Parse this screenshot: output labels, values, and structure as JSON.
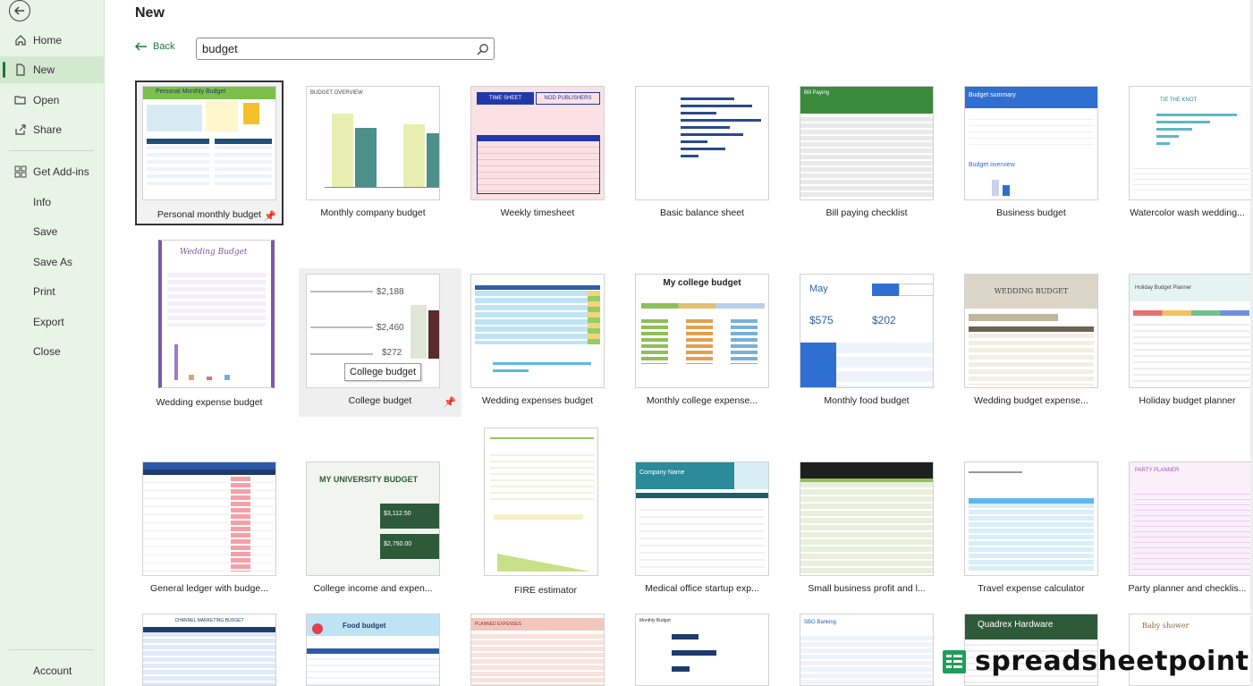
{
  "sidebar": {
    "items": [
      {
        "label": "Home",
        "icon": "home-icon"
      },
      {
        "label": "New",
        "icon": "new-file-icon"
      },
      {
        "label": "Open",
        "icon": "open-folder-icon"
      },
      {
        "label": "Share",
        "icon": "share-icon"
      },
      {
        "label": "Get Add-ins",
        "icon": "add-ins-icon"
      },
      {
        "label": "Info"
      },
      {
        "label": "Save"
      },
      {
        "label": "Save As"
      },
      {
        "label": "Print"
      },
      {
        "label": "Export"
      },
      {
        "label": "Close"
      },
      {
        "label": "Account"
      }
    ]
  },
  "header": {
    "title": "New",
    "back_label": "Back"
  },
  "search": {
    "value": "budget",
    "placeholder": ""
  },
  "tooltip": "College budget",
  "templates": [
    {
      "label": "Personal monthly budget",
      "thumb_title": "Personal Monthly Budget"
    },
    {
      "label": "Monthly company budget",
      "thumb_title": "BUDGET OVERVIEW"
    },
    {
      "label": "Weekly timesheet",
      "thumb_title": "TIME SHEET",
      "thumb_title2": "NOD PUBLISHERS"
    },
    {
      "label": "Basic balance sheet"
    },
    {
      "label": "Bill paying checklist",
      "thumb_title": "Bill Paying"
    },
    {
      "label": "Business budget",
      "thumb_title": "Budget summary",
      "thumb_title2": "Budget overview"
    },
    {
      "label": "Watercolor wash wedding...",
      "thumb_title": "TIE THE KNOT"
    },
    {
      "label": "Wedding expense budget",
      "thumb_title": "Wedding Budget"
    },
    {
      "label": "College budget",
      "values": [
        "$2,188",
        "$2,460",
        "$272"
      ]
    },
    {
      "label": "Wedding expenses budget"
    },
    {
      "label": "Monthly college expense...",
      "thumb_title": "My college budget"
    },
    {
      "label": "Monthly food budget",
      "thumb_title": "May",
      "values": [
        "$575",
        "$202"
      ]
    },
    {
      "label": "Wedding budget expense...",
      "thumb_title": "WEDDING BUDGET"
    },
    {
      "label": "Holiday budget planner",
      "thumb_title": "Holiday Budget Planner"
    },
    {
      "label": "General ledger with budge..."
    },
    {
      "label": "College income and expen...",
      "thumb_title": "MY UNIVERSITY BUDGET",
      "values": [
        "$3,112.50",
        "$2,750.00"
      ]
    },
    {
      "label": "FIRE estimator"
    },
    {
      "label": "Medical office startup exp...",
      "thumb_title": "Company Name"
    },
    {
      "label": "Small business profit and l..."
    },
    {
      "label": "Travel expense calculator"
    },
    {
      "label": "Party planner and checklis...",
      "thumb_title": "PARTY PLANNER"
    },
    {
      "label": "",
      "thumb_title": "CHANNEL MARKETING BUDGET"
    },
    {
      "label": "",
      "thumb_title": "Food budget"
    },
    {
      "label": "",
      "thumb_title": "PLANNED EXPENSES"
    },
    {
      "label": "",
      "thumb_title": "Monthly Budget"
    },
    {
      "label": "",
      "thumb_title": "SBO Banking"
    },
    {
      "label": "",
      "thumb_title": "Quadrex Hardware"
    },
    {
      "label": "",
      "thumb_title": "Baby shower"
    }
  ],
  "watermark": "spreadsheetpoint",
  "colors": {
    "accent": "#217346",
    "sidebar": "#e8f4e6"
  }
}
